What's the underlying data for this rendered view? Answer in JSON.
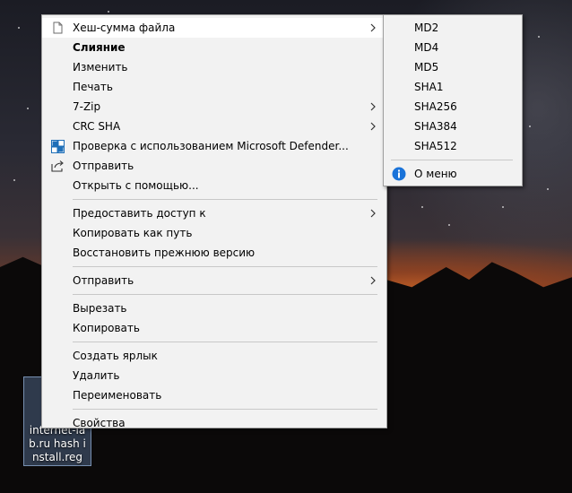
{
  "desktop": {
    "icon_label": "internet-lab.ru hash install.reg"
  },
  "context_menu": {
    "items": [
      {
        "label": "Хеш-сумма файла",
        "icon": "file-icon",
        "submenu": true,
        "highlighted": true
      },
      {
        "label": "Слияние",
        "bold": true
      },
      {
        "label": "Изменить"
      },
      {
        "label": "Печать"
      },
      {
        "label": "7-Zip",
        "submenu": true
      },
      {
        "label": "CRC SHA",
        "submenu": true
      },
      {
        "label": "Проверка с использованием Microsoft Defender...",
        "icon": "defender-icon"
      },
      {
        "label": "Отправить",
        "icon": "share-icon"
      },
      {
        "label": "Открыть с помощью..."
      }
    ],
    "group2": [
      {
        "label": "Предоставить доступ к",
        "submenu": true
      },
      {
        "label": "Копировать как путь"
      },
      {
        "label": "Восстановить прежнюю версию"
      }
    ],
    "group3": [
      {
        "label": "Отправить",
        "submenu": true
      }
    ],
    "group4": [
      {
        "label": "Вырезать"
      },
      {
        "label": "Копировать"
      }
    ],
    "group5": [
      {
        "label": "Создать ярлык"
      },
      {
        "label": "Удалить"
      },
      {
        "label": "Переименовать"
      }
    ],
    "group6": [
      {
        "label": "Свойства"
      }
    ]
  },
  "hash_submenu": {
    "items": [
      "MD2",
      "MD4",
      "MD5",
      "SHA1",
      "SHA256",
      "SHA384",
      "SHA512"
    ],
    "about_label": "О меню",
    "about_icon": "info-icon"
  },
  "colors": {
    "menu_bg": "#f2f2f2",
    "highlight": "#ffffff",
    "info_blue": "#1a73d9",
    "defender_blue": "#1f6fb8"
  }
}
